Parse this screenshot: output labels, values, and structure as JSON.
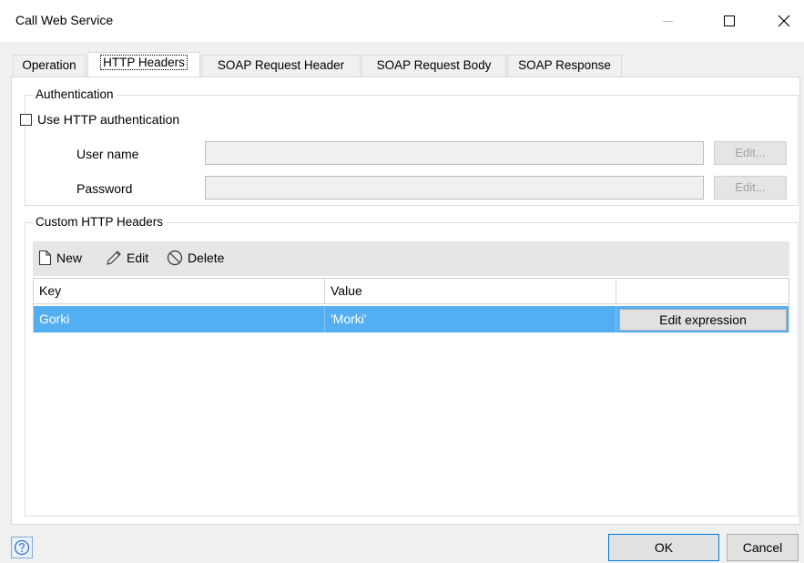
{
  "window": {
    "title": "Call Web Service",
    "controls": {
      "minimize_icon": "minimize-icon",
      "maximize_icon": "maximize-icon",
      "close_icon": "close-icon"
    }
  },
  "tabs": [
    {
      "label": "Operation",
      "active": false
    },
    {
      "label": "HTTP Headers",
      "active": true
    },
    {
      "label": "SOAP Request Header",
      "active": false
    },
    {
      "label": "SOAP Request Body",
      "active": false
    },
    {
      "label": "SOAP Response",
      "active": false
    }
  ],
  "authentication": {
    "legend": "Authentication",
    "use_http_auth_label": "Use HTTP authentication",
    "use_http_auth_checked": false,
    "username_label": "User name",
    "username_value": "",
    "password_label": "Password",
    "password_value": "",
    "edit_label": "Edit..."
  },
  "custom_headers": {
    "legend": "Custom HTTP Headers",
    "toolbar": {
      "new_label": "New",
      "edit_label": "Edit",
      "delete_label": "Delete"
    },
    "columns": [
      "Key",
      "Value",
      ""
    ],
    "rows": [
      {
        "key": "Gorki",
        "value": "'Morki'",
        "action_label": "Edit expression",
        "selected": true
      }
    ]
  },
  "footer": {
    "help_icon": "help-icon",
    "ok_label": "OK",
    "cancel_label": "Cancel"
  },
  "colors": {
    "selection": "#54aef2",
    "panel_bg": "#ffffff",
    "window_bg": "#f0f0f0"
  }
}
